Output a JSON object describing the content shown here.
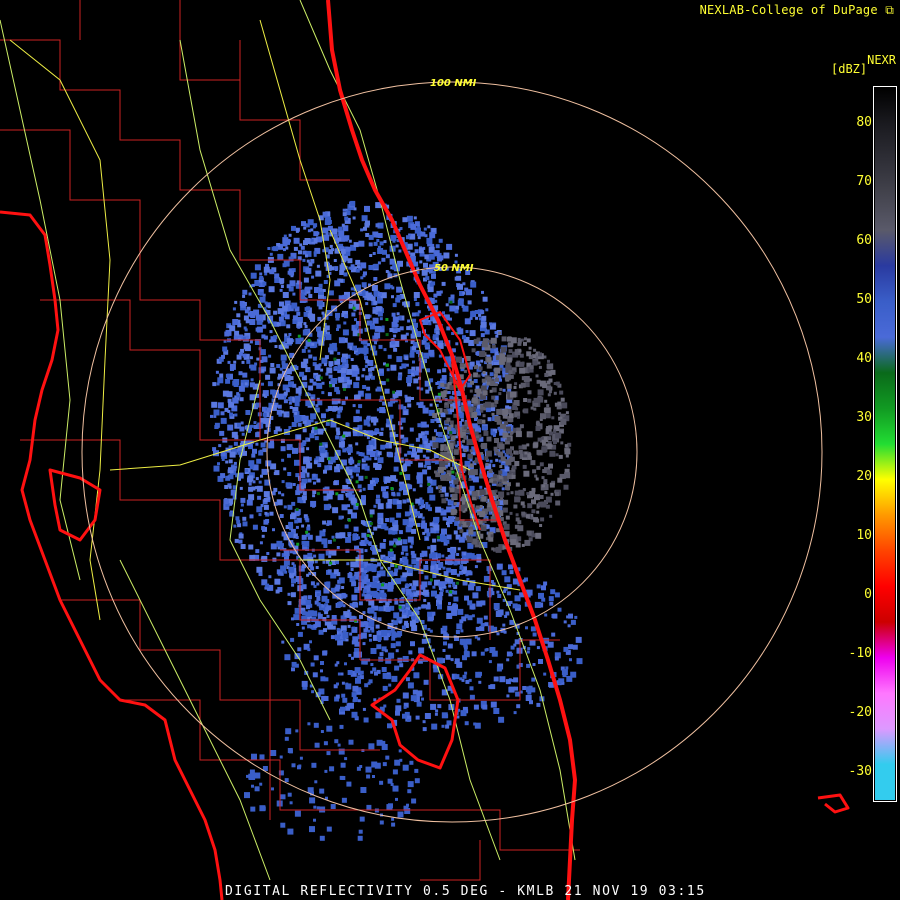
{
  "header": {
    "credit": "NEXLAB-College of DuPage"
  },
  "scale": {
    "product": "NEXR",
    "units": "[dBZ]",
    "ticks": [
      "80",
      "70",
      "60",
      "50",
      "40",
      "30",
      "20",
      "10",
      "0",
      "-10",
      "-20",
      "-30"
    ],
    "colors": [
      "#000000",
      "#1a1a1f",
      "#2e2e36",
      "#44444e",
      "#5a5a6a",
      "#2a3aa0",
      "#3a5ec8",
      "#4a6ad8",
      "#0a6a1a",
      "#119a22",
      "#22dd33",
      "#ffff00",
      "#ff9900",
      "#ff4400",
      "#ff0000",
      "#cc0000",
      "#ee00ee",
      "#ff77ff",
      "#dd99ff",
      "#33ccee"
    ]
  },
  "map": {
    "rings": [
      {
        "label": "100 NMI"
      },
      {
        "label": "50 NMI"
      }
    ],
    "colors": {
      "coast": "#ff1111",
      "county": "#cc2222",
      "road": "#eeee44",
      "road2": "#ccee66",
      "ring": "#f0c0a0"
    }
  },
  "footer": {
    "product_line": "DIGITAL REFLECTIVITY 0.5 DEG - KMLB 21 NOV 19 03:15"
  }
}
